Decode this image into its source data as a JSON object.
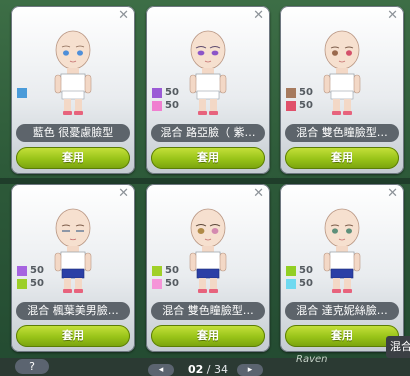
{
  "cards": [
    {
      "label": "藍色 很憂慮臉型",
      "apply": "套用",
      "eye": "#4f8fd9",
      "swatches": [
        {
          "color": "#4a9bd9",
          "pct": ""
        }
      ]
    },
    {
      "label": "混合 路亞臉（ 紫…",
      "apply": "套用",
      "eye": "#8c55c8",
      "swatches": [
        {
          "color": "#9b5bd6",
          "pct": "50"
        },
        {
          "color": "#f07fd0",
          "pct": "50"
        }
      ]
    },
    {
      "label": "混合 雙色瞳臉型…",
      "apply": "套用",
      "eye": "#9a6a4e",
      "swatches": [
        {
          "color": "#a67a5e",
          "pct": "50"
        },
        {
          "color": "#e0506a",
          "pct": "50"
        }
      ]
    },
    {
      "label": "混合 楓葉美男臉…",
      "apply": "套用",
      "eye": "#6a7f9a",
      "swatches": [
        {
          "color": "#a664e0",
          "pct": "50"
        },
        {
          "color": "#9ccf28",
          "pct": "50"
        }
      ]
    },
    {
      "label": "混合 雙色瞳臉型…",
      "apply": "套用",
      "eye": "#b08a46",
      "swatches": [
        {
          "color": "#a0d028",
          "pct": "50"
        },
        {
          "color": "#f595d8",
          "pct": "50"
        }
      ]
    },
    {
      "label": "混合 達克妮絲臉…",
      "apply": "套用",
      "eye": "#5e8f7a",
      "swatches": [
        {
          "color": "#92cf24",
          "pct": "50"
        },
        {
          "color": "#6fd9f0",
          "pct": "50"
        }
      ]
    }
  ],
  "pager": {
    "current": "02",
    "total": "/ 34",
    "prev": "◂",
    "next": "▸"
  },
  "help": "?",
  "side_tip": "混合",
  "nameplate": "Raven"
}
